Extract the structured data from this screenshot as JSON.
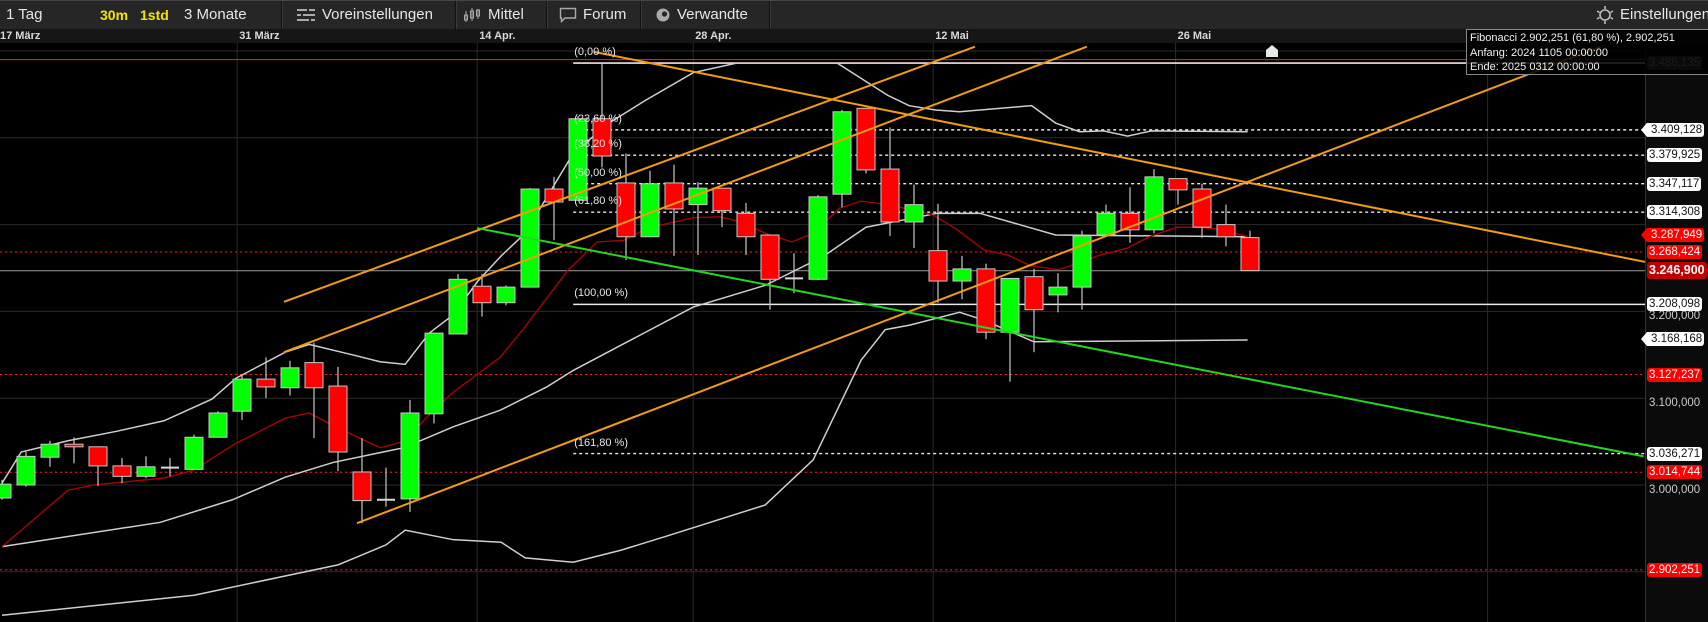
{
  "toolbar": {
    "items": [
      {
        "label": "1 Tag"
      },
      {
        "label": "30m"
      },
      {
        "label": "1std"
      },
      {
        "label": "3 Monate"
      },
      {
        "label": "Voreinstellungen",
        "icon": "sliders-icon"
      },
      {
        "label": "Mittel",
        "icon": "candles-icon"
      },
      {
        "label": "Forum",
        "icon": "speech-bubble-icon"
      },
      {
        "label": "Verwandte",
        "icon": "eye-icon"
      }
    ],
    "settings": {
      "label": "Einstellungen",
      "icon": "gear-icon"
    }
  },
  "tooltip": {
    "line1": "Fibonacci 2.902,251 (61,80 %), 2.902,251",
    "line2": "Anfang: 2024 1105 00:00:00",
    "line3": "Ende: 2025 0312 00:00:00"
  },
  "colors": {
    "up": "#00ff00",
    "down": "#ff0000",
    "orange": "#f39c12",
    "green_line": "#22d622",
    "ma": "#b00000",
    "band": "#cfcfcf"
  },
  "chart_data": {
    "type": "candlestick",
    "x_labels": [
      {
        "label": "17 März",
        "index": -0.2
      },
      {
        "label": "31 März",
        "index": 9.8
      },
      {
        "label": "14 Apr.",
        "index": 19.8
      },
      {
        "label": "28 Apr.",
        "index": 28.8
      },
      {
        "label": "12 Mai",
        "index": 38.8
      },
      {
        "label": "26 Mai",
        "index": 48.9
      }
    ],
    "extra_vgrid_index": [
      61.9
    ],
    "ylim": [
      2855,
      3545
    ],
    "y_grid": [
      2900,
      3000,
      3100,
      3200,
      3300,
      3400,
      3500
    ],
    "candles": [
      [
        2985,
        3006,
        2983,
        3001
      ],
      [
        3000,
        3038,
        2998,
        3033
      ],
      [
        3032,
        3051,
        3021,
        3047
      ],
      [
        3047,
        3055,
        3025,
        3044
      ],
      [
        3044,
        3044,
        2999,
        3022
      ],
      [
        3022,
        3031,
        3002,
        3010
      ],
      [
        3010,
        3033,
        3008,
        3021
      ],
      [
        3020,
        3031,
        3010,
        3020
      ],
      [
        3018,
        3058,
        3018,
        3055
      ],
      [
        3055,
        3085,
        3055,
        3083
      ],
      [
        3085,
        3127,
        3075,
        3122
      ],
      [
        3122,
        3147,
        3100,
        3113
      ],
      [
        3112,
        3143,
        3103,
        3135
      ],
      [
        3141,
        3164,
        3054,
        3112
      ],
      [
        3114,
        3136,
        3016,
        3038
      ],
      [
        3015,
        3054,
        2956,
        2982
      ],
      [
        2983,
        3020,
        2975,
        2983
      ],
      [
        2984,
        3098,
        2969,
        3083
      ],
      [
        3082,
        3175,
        3071,
        3175
      ],
      [
        3174,
        3243,
        3174,
        3237
      ],
      [
        3229,
        3243,
        3194,
        3210
      ],
      [
        3210,
        3230,
        3207,
        3228
      ],
      [
        3228,
        3342,
        3228,
        3341
      ],
      [
        3341,
        3355,
        3282,
        3326
      ],
      [
        3328,
        3425,
        3328,
        3422
      ],
      [
        3422,
        3486,
        3366,
        3379
      ],
      [
        3348,
        3382,
        3259,
        3286
      ],
      [
        3286,
        3362,
        3286,
        3347
      ],
      [
        3348,
        3369,
        3264,
        3318
      ],
      [
        3323,
        3349,
        3265,
        3342
      ],
      [
        3342,
        3342,
        3297,
        3316
      ],
      [
        3313,
        3325,
        3265,
        3286
      ],
      [
        3288,
        3288,
        3202,
        3237
      ],
      [
        3238,
        3267,
        3221,
        3238
      ],
      [
        3237,
        3334,
        3236,
        3332
      ],
      [
        3335,
        3432,
        3320,
        3430
      ],
      [
        3434,
        3434,
        3359,
        3363
      ],
      [
        3364,
        3412,
        3287,
        3303
      ],
      [
        3303,
        3346,
        3273,
        3323
      ],
      [
        3270,
        3324,
        3210,
        3235
      ],
      [
        3235,
        3264,
        3214,
        3249
      ],
      [
        3249,
        3255,
        3168,
        3176
      ],
      [
        3176,
        3238,
        3119,
        3238
      ],
      [
        3240,
        3249,
        3153,
        3202
      ],
      [
        3219,
        3244,
        3199,
        3228
      ],
      [
        3228,
        3293,
        3202,
        3287
      ],
      [
        3288,
        3323,
        3288,
        3313
      ],
      [
        3313,
        3343,
        3279,
        3294
      ],
      [
        3294,
        3364,
        3290,
        3355
      ],
      [
        3353,
        3353,
        3323,
        3340
      ],
      [
        3341,
        3347,
        3285,
        3297
      ],
      [
        3300,
        3323,
        3275,
        3286
      ],
      [
        3285,
        3293,
        3247,
        3247
      ]
    ],
    "indicators": [
      {
        "name": "bollinger-upper",
        "color": "#cfcfcf",
        "points": [
          [
            0,
            3002
          ],
          [
            0.8,
            3038
          ],
          [
            2.75,
            3051
          ],
          [
            4.8,
            3062
          ],
          [
            6.75,
            3074
          ],
          [
            8.75,
            3099
          ],
          [
            9.75,
            3123
          ],
          [
            11.8,
            3153
          ],
          [
            12.8,
            3162
          ],
          [
            14.75,
            3149
          ],
          [
            15.75,
            3142
          ],
          [
            16.8,
            3139
          ],
          [
            17.8,
            3175
          ],
          [
            18.8,
            3196
          ],
          [
            19.8,
            3234
          ],
          [
            20.8,
            3264
          ],
          [
            21.8,
            3290
          ],
          [
            23.8,
            3382
          ],
          [
            25.3,
            3417
          ],
          [
            26.8,
            3443
          ],
          [
            28.8,
            3475
          ],
          [
            30.6,
            3486
          ],
          [
            34.8,
            3486
          ],
          [
            36.9,
            3449
          ],
          [
            37.8,
            3437
          ],
          [
            38.9,
            3432
          ],
          [
            39.9,
            3430
          ],
          [
            42.9,
            3437
          ],
          [
            43.9,
            3417
          ],
          [
            44.9,
            3407
          ],
          [
            45.9,
            3408
          ],
          [
            46.9,
            3402
          ],
          [
            47.9,
            3408
          ],
          [
            51.9,
            3407
          ]
        ]
      },
      {
        "name": "bollinger-middle",
        "color": "#cfcfcf",
        "points": [
          [
            0,
            2929
          ],
          [
            6.6,
            2957
          ],
          [
            9.6,
            2983
          ],
          [
            11.8,
            3009
          ],
          [
            13.8,
            3026
          ],
          [
            15.7,
            3037
          ],
          [
            16.75,
            3043
          ],
          [
            18.8,
            3067
          ],
          [
            20.75,
            3086
          ],
          [
            22.7,
            3113
          ],
          [
            23.8,
            3132
          ],
          [
            28.8,
            3205
          ],
          [
            31.8,
            3230
          ],
          [
            34.2,
            3263
          ],
          [
            36,
            3297
          ],
          [
            38.96,
            3313
          ],
          [
            40.75,
            3313
          ],
          [
            43.9,
            3288
          ],
          [
            51.9,
            3286
          ]
        ]
      },
      {
        "name": "bollinger-lower",
        "color": "#cfcfcf",
        "points": [
          [
            0,
            2850
          ],
          [
            8,
            2873
          ],
          [
            14,
            2908
          ],
          [
            14.7,
            2916
          ],
          [
            16,
            2931
          ],
          [
            16.8,
            2948
          ],
          [
            18.8,
            2937
          ],
          [
            20.8,
            2934
          ],
          [
            21.8,
            2916
          ],
          [
            23.8,
            2911
          ],
          [
            25.8,
            2925
          ],
          [
            27.8,
            2942
          ],
          [
            31.8,
            2977
          ],
          [
            33.8,
            3029
          ],
          [
            35.8,
            3144
          ],
          [
            36.8,
            3179
          ],
          [
            37.8,
            3184
          ],
          [
            39.9,
            3199
          ],
          [
            40.9,
            3190
          ],
          [
            43,
            3165
          ],
          [
            51.9,
            3167
          ]
        ]
      },
      {
        "name": "moving-average",
        "color": "#b00000",
        "points": [
          [
            0,
            2929
          ],
          [
            2.75,
            2994
          ],
          [
            3.8,
            3000
          ],
          [
            6.75,
            3008
          ],
          [
            7.96,
            3017
          ],
          [
            9.75,
            3048
          ],
          [
            11.8,
            3077
          ],
          [
            12.8,
            3083
          ],
          [
            13.75,
            3069
          ],
          [
            15.75,
            3043
          ],
          [
            16.75,
            3050
          ],
          [
            17.8,
            3081
          ],
          [
            18.8,
            3107
          ],
          [
            20.75,
            3147
          ],
          [
            21.7,
            3179
          ],
          [
            23.6,
            3248
          ],
          [
            24.8,
            3280
          ],
          [
            25.9,
            3282
          ],
          [
            26.9,
            3296
          ],
          [
            28.8,
            3308
          ],
          [
            29.9,
            3309
          ],
          [
            30.8,
            3303
          ],
          [
            31.8,
            3290
          ],
          [
            32.9,
            3280
          ],
          [
            33.8,
            3290
          ],
          [
            34.9,
            3319
          ],
          [
            35.8,
            3327
          ],
          [
            36.9,
            3323
          ],
          [
            37.9,
            3317
          ],
          [
            38.8,
            3311
          ],
          [
            39.8,
            3294
          ],
          [
            40.9,
            3271
          ],
          [
            41.9,
            3265
          ],
          [
            42.8,
            3253
          ],
          [
            44,
            3248
          ],
          [
            44.9,
            3256
          ],
          [
            45.75,
            3265
          ],
          [
            46.9,
            3273
          ],
          [
            47.8,
            3286
          ],
          [
            48.96,
            3297
          ],
          [
            49.9,
            3297
          ],
          [
            50.9,
            3294
          ],
          [
            51.9,
            3286
          ]
        ]
      }
    ],
    "trendlines": [
      {
        "name": "orange-channel-top",
        "color": "#f39c12",
        "from": [
          11.75,
          3211
        ],
        "to": [
          40.54,
          3505
        ]
      },
      {
        "name": "orange-channel-middle",
        "color": "#f39c12",
        "from": [
          11.75,
          3153
        ],
        "to": [
          45.2,
          3505
        ]
      },
      {
        "name": "orange-channel-bottom",
        "color": "#f39c12",
        "from": [
          14.79,
          2956
        ],
        "to": [
          66.6,
          3505
        ]
      },
      {
        "name": "orange-descending-line",
        "color": "#f39c12",
        "from": [
          24.67,
          3499
        ],
        "to": [
          68.46,
          3257
        ]
      },
      {
        "name": "green-descending-line",
        "color": "#22d622",
        "from": [
          19.8,
          3296
        ],
        "to": [
          68.4,
          3033
        ]
      }
    ],
    "fibonacci": {
      "start_index": 23.8,
      "levels": [
        {
          "label": "(0,00 %)",
          "value": 3486.135,
          "style": "solid"
        },
        {
          "label": "(23,60 %)",
          "value": 3409.128,
          "style": "dotted"
        },
        {
          "label": "(38,20 %)",
          "value": 3379.925,
          "style": "dotted"
        },
        {
          "label": "(50,00 %)",
          "value": 3347.117,
          "style": "dotted"
        },
        {
          "label": "(61,80 %)",
          "value": 3314.308,
          "style": "dotted"
        },
        {
          "label": "(100,00 %)",
          "value": 3208.098,
          "style": "solid"
        },
        {
          "label": "(161,80 %)",
          "value": 3036.271,
          "style": "dotted"
        }
      ]
    },
    "hlines": [
      {
        "value": 3490,
        "color": "#ff2020",
        "style": "solid"
      },
      {
        "value": 3268.424,
        "color": "#ff2020",
        "style": "dotted"
      },
      {
        "value": 3127.237,
        "color": "#ff2020",
        "style": "dotted"
      },
      {
        "value": 3014.744,
        "color": "#ff2020",
        "style": "dotted"
      },
      {
        "value": 2902.251,
        "color": "#ff2020",
        "style": "dotted"
      },
      {
        "value": 3246.9,
        "color": "#9a9a9a",
        "style": "solid"
      }
    ],
    "price_labels": [
      {
        "text": "3.486,135",
        "value": 3486.135,
        "style": "gray"
      },
      {
        "text": "3.409,128",
        "value": 3409.128,
        "style": "white-arrow"
      },
      {
        "text": "3.379,925",
        "value": 3379.925,
        "style": "white-box"
      },
      {
        "text": "3.347,117",
        "value": 3347.117,
        "style": "white-box"
      },
      {
        "text": "3.314,308",
        "value": 3314.308,
        "style": "white-box"
      },
      {
        "text": "3.287,949",
        "value": 3287.949,
        "style": "red-arrow"
      },
      {
        "text": "3.268,424",
        "value": 3268.424,
        "style": "red"
      },
      {
        "text": "3.200,000",
        "value": 3200,
        "style": "plain"
      },
      {
        "text": "3.208,098",
        "value": 3208.098,
        "style": "white-box"
      },
      {
        "text": "3.246,900",
        "value": 3246.9,
        "style": "current"
      },
      {
        "text": "3.168,168",
        "value": 3168.168,
        "style": "white-arrow"
      },
      {
        "text": "3.127,237",
        "value": 3127.237,
        "style": "red"
      },
      {
        "text": "3.100,000",
        "value": 3100,
        "style": "plain"
      },
      {
        "text": "3.036,271",
        "value": 3036.271,
        "style": "white-box"
      },
      {
        "text": "3.014,744",
        "value": 3014.744,
        "style": "red"
      },
      {
        "text": "3.000,000",
        "value": 3000,
        "style": "plain"
      },
      {
        "text": "2.902,251",
        "value": 2902.251,
        "style": "red"
      }
    ]
  }
}
